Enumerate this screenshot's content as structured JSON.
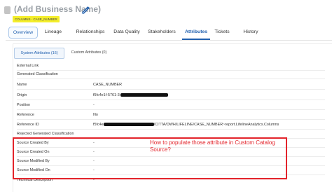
{
  "header": {
    "title": "(Add Business Name)",
    "badge": "COLUMNS · CASE_NUMBER"
  },
  "tabs": [
    {
      "label": "Overview"
    },
    {
      "label": "Lineage"
    },
    {
      "label": "Relationships"
    },
    {
      "label": "Data Quality"
    },
    {
      "label": "Stakeholders"
    },
    {
      "label": "Attributes"
    },
    {
      "label": "Tickets"
    },
    {
      "label": "History"
    }
  ],
  "subtabs": {
    "system": "System Attributes (16)",
    "custom": "Custom Attributes (0)"
  },
  "attributes": [
    {
      "label": "External Link",
      "value": ""
    },
    {
      "label": "Generated Classification",
      "value": ""
    },
    {
      "label": "Name",
      "value": "CASE_NUMBER"
    },
    {
      "label": "Origin",
      "value": "f5fc4e1f-5761-3"
    },
    {
      "label": "Position",
      "value": "-"
    },
    {
      "label": "Reference",
      "value": "No"
    },
    {
      "label": "Reference ID",
      "value_prefix": "f5fc4e",
      "value_suffix": "/CITTA/DWH/LIFELINE/CASE_NUMBER~report.LifelineAnalytics.Columns"
    },
    {
      "label": "Rejected Generated Classification",
      "value": ""
    },
    {
      "label": "Source Created By",
      "value": "-"
    },
    {
      "label": "Source Created On",
      "value": "-"
    },
    {
      "label": "Source Modified By",
      "value": "-"
    },
    {
      "label": "Source Modified On",
      "value": "-"
    },
    {
      "label": "Technical Description",
      "value": "-"
    }
  ],
  "callout": {
    "text": "How to populate those attribute in Custom Catalog Source?",
    "color": "#e3242b"
  },
  "colors": {
    "accent": "#1f5fae",
    "badge": "#f4ee2a",
    "callout": "#e3242b"
  }
}
